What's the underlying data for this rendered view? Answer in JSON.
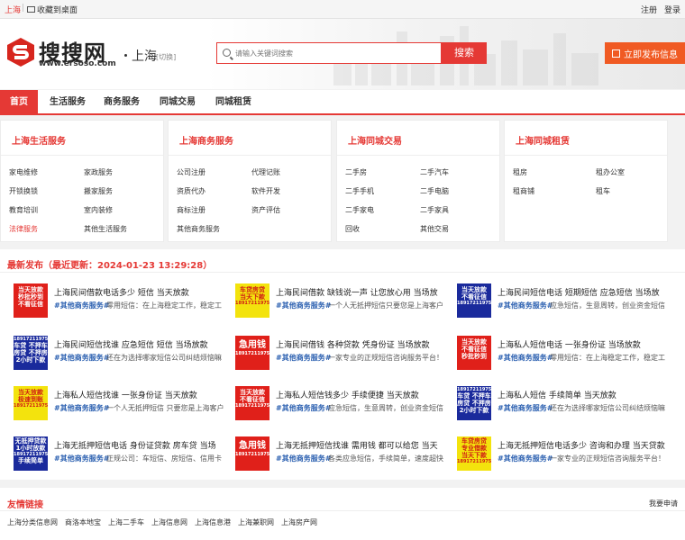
{
  "topbar": {
    "city": "上海",
    "favorite": "收藏到桌面",
    "register": "注册",
    "login": "登录"
  },
  "header": {
    "logo_text": "搜搜网",
    "logo_url": "www.ersoso.com",
    "current_city": "上海",
    "switch_city": "[切换]",
    "search_placeholder": "请输入关键词搜索",
    "search_button": "搜索",
    "publish_button": "立即发布信息"
  },
  "nav": {
    "items": [
      "首页",
      "生活服务",
      "商务服务",
      "同城交易",
      "同城租赁"
    ]
  },
  "categories": [
    {
      "title": "上海生活服务",
      "links": [
        "家电维修",
        "家政服务",
        "开锁换锁",
        "搬家服务",
        "教育培训",
        "室内装修",
        "法律服务",
        "其他生活服务"
      ]
    },
    {
      "title": "上海商务服务",
      "links": [
        "公司注册",
        "代理记账",
        "资质代办",
        "软件开发",
        "商标注册",
        "资产评估",
        "其他商务服务"
      ]
    },
    {
      "title": "上海同城交易",
      "links": [
        "二手房",
        "二手汽车",
        "二手手机",
        "二手电脑",
        "二手家电",
        "二手家具",
        "回收",
        "其他交易"
      ]
    },
    {
      "title": "上海同城租赁",
      "links": [
        "租房",
        "租办公室",
        "租商铺",
        "租车"
      ]
    }
  ],
  "latest": {
    "heading": "最新发布（最近更新：2024-01-23 13:29:28）",
    "posts": [
      {
        "title": "上海民间借款电话多少 短信 当天放款",
        "category": "#其他商务服务#",
        "desc": "零用短信：在上海稳定工作，稳定工"
      },
      {
        "title": "上海民间借款 缺钱说一声 让您放心用 当场放",
        "category": "#其他商务服务#",
        "desc": "一个人无抵押短信只要您是上海客户"
      },
      {
        "title": "上海民间短信电话 短期短信 应急短信 当场放",
        "category": "#其他商务服务#",
        "desc": "应急短信，生意周转，创业资金短信"
      },
      {
        "title": "上海民间短信找谁 应急短信 短信 当场放款",
        "category": "#其他商务服务#",
        "desc": "还在为选择哪家短信公司纠结烦恼嘛"
      },
      {
        "title": "上海民间借钱 各种贷款 凭身份证 当场放款",
        "category": "#其他商务服务#",
        "desc": "一家专业的正规短信咨询服务平台！"
      },
      {
        "title": "上海私人短信电话 一张身份证 当场放款",
        "category": "#其他商务服务#",
        "desc": "零用短信：在上海稳定工作，稳定工"
      },
      {
        "title": "上海私人短信找谁 一张身份证 当天放款",
        "category": "#其他商务服务#",
        "desc": "一个人无抵押短信 只要您是上海客户"
      },
      {
        "title": "上海私人短信钱多少 手续便捷 当天放款",
        "category": "#其他商务服务#",
        "desc": "应急短信，生意周转，创业资金短信"
      },
      {
        "title": "上海私人短信 手续简单 当天放款",
        "category": "#其他商务服务#",
        "desc": "还在为选择哪家短信公司纠结烦恼嘛"
      },
      {
        "title": "上海无抵押短信电话 身份证贷款 房车贷 当场",
        "category": "#其他商务服务#",
        "desc": "正规公司：车短信、房短信、信用卡"
      },
      {
        "title": "上海无抵押短信找谁 需用钱 都可以给您 当天",
        "category": "#其他商务服务#",
        "desc": "各类应急短信，手续简单，速度超快"
      },
      {
        "title": "上海无抵押短信电话多少 咨询和办理 当天贷款",
        "category": "#其他商务服务#",
        "desc": "一家专业的正规短信咨询服务平台！"
      }
    ],
    "thumbs": [
      {
        "style": "red",
        "lines": [
          "当天放款",
          "秒批秒到",
          "不看征信"
        ]
      },
      {
        "style": "yellow",
        "lines": [
          "车贷房贷",
          "当天下款",
          "18917211975"
        ]
      },
      {
        "style": "blue",
        "lines": [
          "当天放款",
          "不看征信",
          "18917211975"
        ]
      },
      {
        "style": "blue",
        "lines": [
          "18917211975",
          "车贷 不押车",
          "房贷 不押房",
          "2小时下款"
        ]
      },
      {
        "style": "red",
        "lines": [
          "急用钱",
          "18917211975"
        ]
      },
      {
        "style": "red",
        "lines": [
          "当天放款",
          "不看征信",
          "秒批秒到"
        ]
      },
      {
        "style": "yellow",
        "lines": [
          "当天放款",
          "极速到账",
          "18917211975"
        ]
      },
      {
        "style": "red",
        "lines": [
          "当天放款",
          "不看征信",
          "18917211975"
        ]
      },
      {
        "style": "blue",
        "lines": [
          "18917211975",
          "车贷 不押车",
          "房贷 不押房",
          "2小时下款"
        ]
      },
      {
        "style": "blue",
        "lines": [
          "无抵押贷款",
          "1小时放款",
          "18917211975",
          "手续简单"
        ]
      },
      {
        "style": "red",
        "lines": [
          "急用钱",
          "18917211975"
        ]
      },
      {
        "style": "yellow",
        "lines": [
          "车贷房贷",
          "专业借款",
          "当天下款",
          "18917211975"
        ]
      }
    ]
  },
  "friend_links": {
    "title": "友情链接",
    "apply": "我要申请",
    "links": [
      "上海分类信息网",
      "商洛本地宝",
      "上海二手车",
      "上海信息网",
      "上海信息港",
      "上海兼职网",
      "上海房产网"
    ]
  },
  "colors": {
    "accent": "#e53935",
    "publish": "#f05a23",
    "category_link": "#2a5fb0"
  }
}
